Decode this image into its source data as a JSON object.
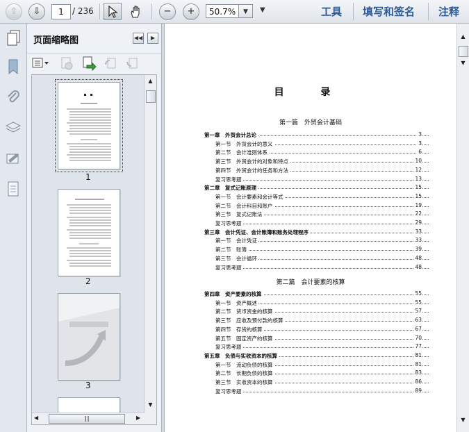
{
  "toolbar": {
    "page_current": "1",
    "page_total": "/ 236",
    "zoom": "50.7%",
    "right_links": [
      "工具",
      "填写和签名",
      "注释"
    ]
  },
  "panel": {
    "title": "页面缩略图",
    "thumbnails": [
      "1",
      "2",
      "3"
    ]
  },
  "document": {
    "title": "目 录",
    "parts": [
      "第一篇　外贸会计基础",
      "第二篇　会计要素的核算"
    ],
    "toc_part1": [
      {
        "kind": "ch",
        "label": "第一章　外贸会计总论",
        "page": "3"
      },
      {
        "kind": "sec",
        "label": "第一节　外贸会计的意义",
        "page": "3"
      },
      {
        "kind": "sec",
        "label": "第二节　会计准则体系",
        "page": "6"
      },
      {
        "kind": "sec",
        "label": "第三节　外贸会计的对象和特点",
        "page": "10"
      },
      {
        "kind": "sec",
        "label": "第四节　外贸会计的任务和方法",
        "page": "12"
      },
      {
        "kind": "sec",
        "label": "复习思考题",
        "page": "13"
      },
      {
        "kind": "ch",
        "label": "第二章　复式记账原理",
        "page": "15"
      },
      {
        "kind": "sec",
        "label": "第一节　会计要素和会计等式",
        "page": "15"
      },
      {
        "kind": "sec",
        "label": "第二节　会计科目和账户",
        "page": "19"
      },
      {
        "kind": "sec",
        "label": "第三节　复式记账法",
        "page": "22"
      },
      {
        "kind": "sec",
        "label": "复习思考题",
        "page": "29"
      },
      {
        "kind": "ch",
        "label": "第三章　会计凭证、会计账簿和账务处理程序",
        "page": "33"
      },
      {
        "kind": "sec",
        "label": "第一节　会计凭证",
        "page": "33"
      },
      {
        "kind": "sec",
        "label": "第二节　账簿",
        "page": "39"
      },
      {
        "kind": "sec",
        "label": "第三节　会计循环",
        "page": "48"
      },
      {
        "kind": "sec",
        "label": "复习思考题",
        "page": "48"
      }
    ],
    "toc_part2": [
      {
        "kind": "ch",
        "label": "第四章　资产要素的核算",
        "page": "55"
      },
      {
        "kind": "sec",
        "label": "第一节　资产概述",
        "page": "55"
      },
      {
        "kind": "sec",
        "label": "第二节　货币资金的核算",
        "page": "57"
      },
      {
        "kind": "sec",
        "label": "第三节　应收及预付款的核算",
        "page": "63"
      },
      {
        "kind": "sec",
        "label": "第四节　存货的核算",
        "page": "67"
      },
      {
        "kind": "sec",
        "label": "第五节　固定资产的核算",
        "page": "70"
      },
      {
        "kind": "sec",
        "label": "复习思考题",
        "page": "77"
      },
      {
        "kind": "ch",
        "label": "第五章　负债与实收资本的核算",
        "page": "81"
      },
      {
        "kind": "sec",
        "label": "第一节　流动负债的核算",
        "page": "81"
      },
      {
        "kind": "sec",
        "label": "第二节　长期负债的核算",
        "page": "83"
      },
      {
        "kind": "sec",
        "label": "第三节　实收资本的核算",
        "page": "86"
      },
      {
        "kind": "sec",
        "label": "复习思考题",
        "page": "89"
      }
    ]
  }
}
